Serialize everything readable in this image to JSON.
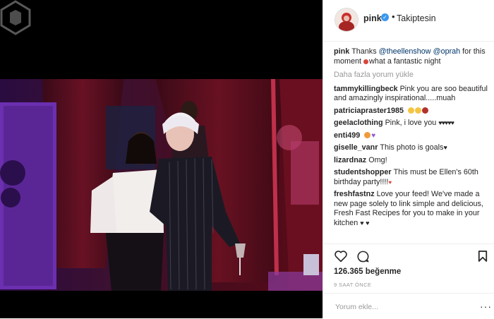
{
  "post": {
    "username": "pink",
    "follow_status": "Takiptesin",
    "caption_user": "pink",
    "caption_text_a": "Thanks ",
    "caption_mention1": "@theellenshow",
    "caption_mention2": "@oprah",
    "caption_text_b": " for this moment ",
    "caption_text_c": "what a fantastic night",
    "load_more": "Daha fazla yorum yükle",
    "likes": "126.365 beğenme",
    "time": "9 SAAT ÖNCE",
    "comment_placeholder": "Yorum ekle...",
    "more_options": "···"
  },
  "comments": [
    {
      "user": "tammykillingbeck",
      "text": "Pink you are soo beautiful and amazingly inspirational.....muah"
    },
    {
      "user": "patriciapraster1985",
      "text": ""
    },
    {
      "user": "geelaclothing",
      "text": "Pink, i love you"
    },
    {
      "user": "enti499",
      "text": ""
    },
    {
      "user": "giselle_vanr",
      "text": "This photo is goals"
    },
    {
      "user": "lizardnaz",
      "text": "Omg!"
    },
    {
      "user": "studentshopper",
      "text": "This must be Ellen's 60th birthday party!!!!"
    },
    {
      "user": "freshfastnz",
      "text": "Love your feed! We've made a new page solely to link simple and delicious, Fresh Fast Recipes for you to make in your kitchen"
    }
  ],
  "colors": {
    "heart": "#262626",
    "link": "#003569",
    "muted": "#999999",
    "verified": "#3897f0",
    "stage_purple": "#6b2fb0",
    "stage_red": "#7a0c1e"
  },
  "icons": {
    "like": "heart-outline-icon",
    "comment": "speech-bubble-icon",
    "save": "bookmark-icon",
    "verified": "verified-badge-icon"
  }
}
